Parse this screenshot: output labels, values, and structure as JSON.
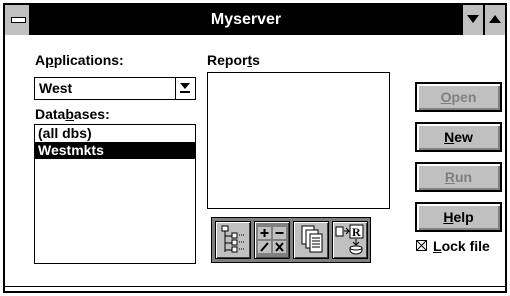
{
  "window": {
    "title": "Myserver"
  },
  "applications": {
    "label_pre": "A",
    "label_key": "p",
    "label_post": "plications:",
    "selected": "West"
  },
  "databases": {
    "label_pre": "Data",
    "label_key": "b",
    "label_post": "ases:",
    "items": [
      "(all dbs)",
      "Westmkts"
    ],
    "selected_index": 1
  },
  "reports": {
    "label_pre": "Repor",
    "label_key": "t",
    "label_post": "s"
  },
  "buttons": {
    "open": {
      "key": "O",
      "rest": "pen",
      "enabled": false
    },
    "new": {
      "key": "N",
      "rest": "ew",
      "enabled": true
    },
    "run": {
      "key": "R",
      "rest": "un",
      "enabled": false
    },
    "help": {
      "key": "H",
      "rest": "elp",
      "enabled": true
    }
  },
  "lock_file": {
    "key": "L",
    "rest": "ock file",
    "checked": true
  },
  "toolbar_icons": [
    "outline-tree-icon",
    "calculator-ops-icon",
    "copy-pages-icon",
    "report-export-icon"
  ]
}
